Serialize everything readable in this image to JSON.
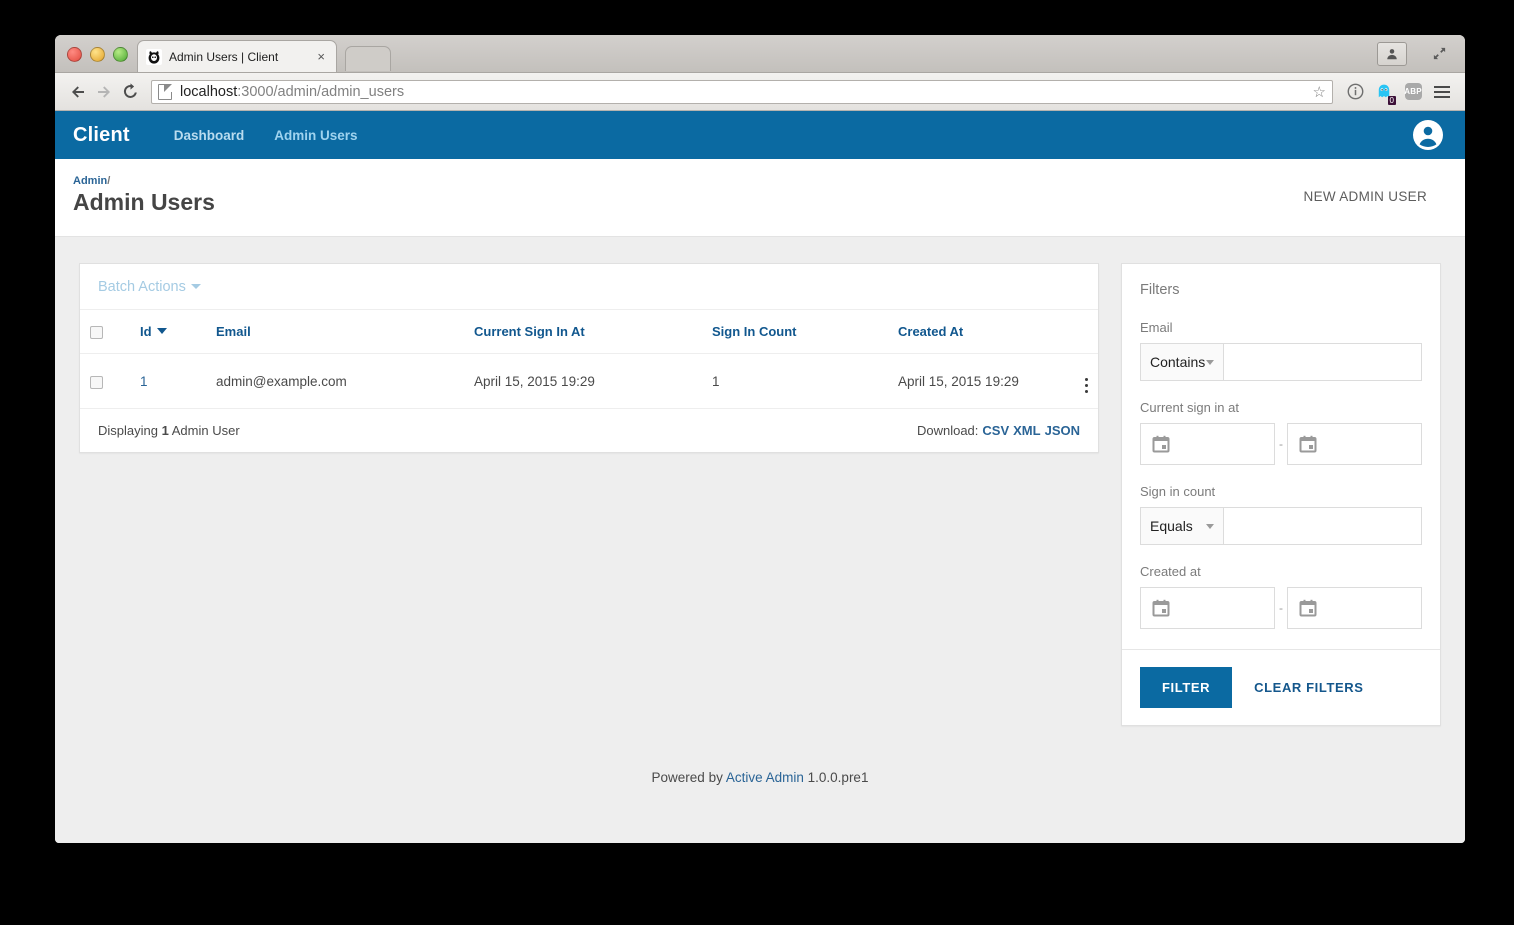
{
  "browser": {
    "tab_title": "Admin Users | Client",
    "tab_close": "×",
    "url_host": "localhost",
    "url_path": ":3000/admin/admin_users",
    "back_icon": "back-arrow-icon",
    "forward_icon": "forward-arrow-icon",
    "reload_icon": "reload-icon",
    "bookmark_icon": "star-icon",
    "info_icon": "info-circle-icon",
    "ghostery_badge": "0",
    "adblock_label": "ABP",
    "menu_icon": "hamburger-menu-icon"
  },
  "app": {
    "brand": "Client",
    "nav": [
      {
        "label": "Dashboard",
        "active": false
      },
      {
        "label": "Admin Users",
        "active": true
      }
    ],
    "avatar_icon": "account-circle-icon"
  },
  "header": {
    "breadcrumb": "Admin",
    "breadcrumb_sep": "/",
    "title": "Admin Users",
    "action_label": "NEW ADMIN USER"
  },
  "index_panel": {
    "batch_actions_label": "Batch Actions",
    "columns": [
      "Id",
      "Email",
      "Current Sign In At",
      "Sign In Count",
      "Created At"
    ],
    "sorted_column": "Id",
    "sort_direction": "desc",
    "rows": [
      {
        "id": "1",
        "email": "admin@example.com",
        "current_sign_in_at": "April 15, 2015 19:29",
        "sign_in_count": "1",
        "created_at": "April 15, 2015 19:29"
      }
    ],
    "footer": {
      "displaying_prefix": "Displaying",
      "displaying_count": "1",
      "displaying_suffix": "Admin User",
      "download_label": "Download:",
      "download_formats": [
        "CSV",
        "XML",
        "JSON"
      ]
    }
  },
  "filters": {
    "title": "Filters",
    "groups": [
      {
        "label": "Email",
        "type": "select_text",
        "operator": "Contains",
        "value": ""
      },
      {
        "label": "Current sign in at",
        "type": "date_range",
        "from": "",
        "to": "",
        "separator": "-"
      },
      {
        "label": "Sign in count",
        "type": "select_text",
        "operator": "Equals",
        "value": ""
      },
      {
        "label": "Created at",
        "type": "date_range",
        "from": "",
        "to": "",
        "separator": "-"
      }
    ],
    "submit_label": "FILTER",
    "clear_label": "CLEAR FILTERS"
  },
  "footer": {
    "prefix": "Powered by",
    "link": "Active Admin",
    "version": "1.0.0.pre1"
  },
  "colors": {
    "brand_blue": "#0b6aa2",
    "link_blue": "#2a6496",
    "header_link": "#11578e",
    "batch_disabled": "#a5cbe3",
    "page_bg": "#eeeeee"
  }
}
